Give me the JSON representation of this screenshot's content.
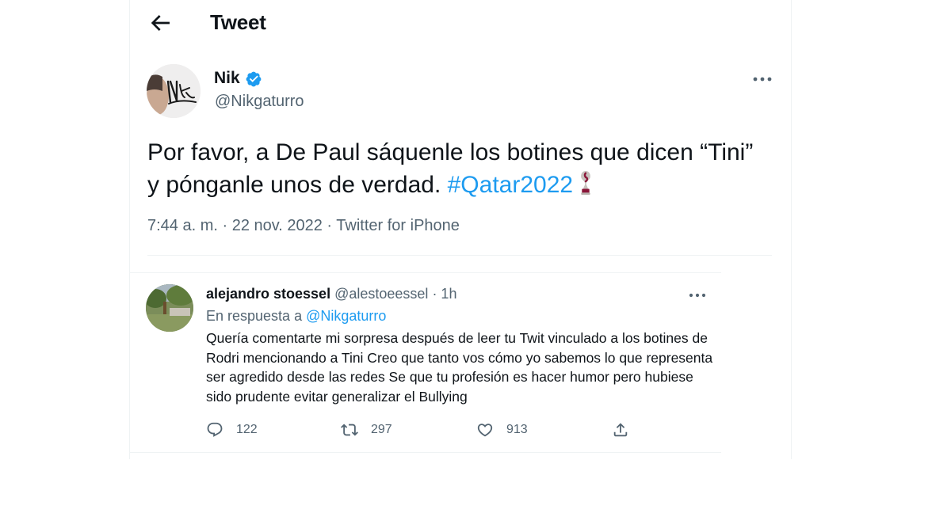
{
  "header": {
    "title": "Tweet",
    "back_icon": "arrow-left-icon"
  },
  "main_tweet": {
    "author_name": "Nik",
    "author_handle": "@Nikgaturro",
    "verified_icon": "verified-badge-icon",
    "text_before": "Por favor, a De Paul sáquenle los botines que dicen “Tini” y pónganle unos de verdad. ",
    "hashtag": "#Qatar2022",
    "emoji_icon": "world-cup-trophy-icon",
    "meta": "7:44 a. m. · 22 nov. 2022 · Twitter for iPhone"
  },
  "reply": {
    "author_name": "alejandro stoessel",
    "author_handle": "@alestoeessel",
    "time": " · 1h",
    "reply_to_label": "En respuesta a ",
    "reply_to_handle": "@Nikgaturro",
    "text": "Quería comentarte mi sorpresa después de leer tu Twit vinculado a los botines de Rodri mencionando a Tini Creo que tanto vos cómo yo sabemos lo que representa ser agredido desde las redes Se que tu profesión es hacer humor pero hubiese sido prudente evitar generalizar el Bullying",
    "actions": {
      "replies": "122",
      "retweets": "297",
      "likes": "913"
    }
  },
  "colors": {
    "accent": "#1d9bf0",
    "secondary_text": "#536471",
    "divider": "#eff3f4"
  }
}
